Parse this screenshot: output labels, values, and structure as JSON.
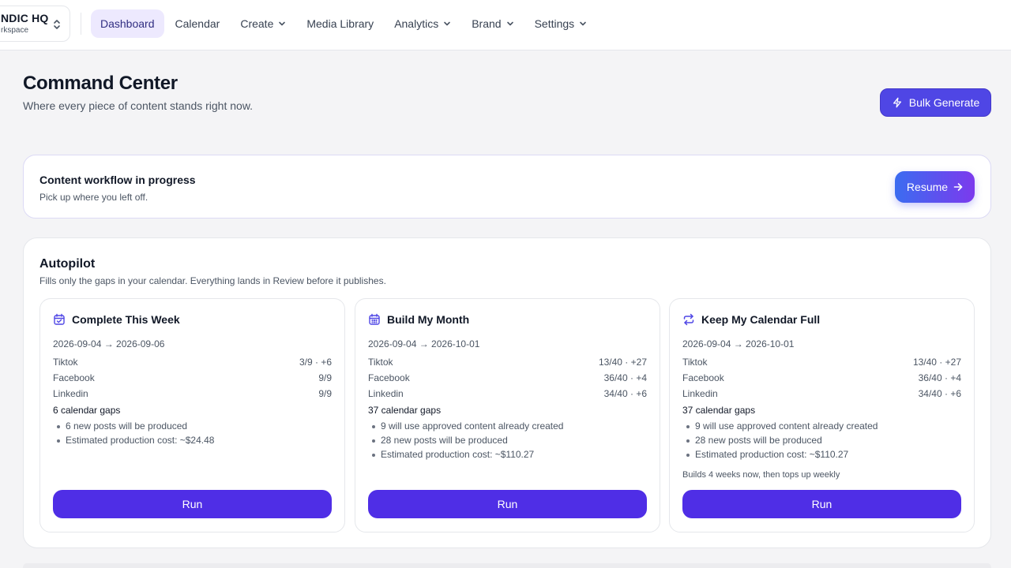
{
  "workspace": {
    "name": "NDIC HQ",
    "sub": "rkspace"
  },
  "nav": {
    "items": [
      {
        "label": "Dashboard",
        "active": true,
        "dropdown": false
      },
      {
        "label": "Calendar",
        "active": false,
        "dropdown": false
      },
      {
        "label": "Create",
        "active": false,
        "dropdown": true
      },
      {
        "label": "Media Library",
        "active": false,
        "dropdown": false
      },
      {
        "label": "Analytics",
        "active": false,
        "dropdown": true
      },
      {
        "label": "Brand",
        "active": false,
        "dropdown": true
      },
      {
        "label": "Settings",
        "active": false,
        "dropdown": true
      }
    ]
  },
  "header": {
    "title": "Command Center",
    "subtitle": "Where every piece of content stands right now.",
    "bulk_label": "Bulk Generate"
  },
  "banner": {
    "title": "Content workflow in progress",
    "subtitle": "Pick up where you left off.",
    "resume_label": "Resume"
  },
  "autopilot": {
    "title": "Autopilot",
    "subtitle": "Fills only the gaps in your calendar. Everything lands in Review before it publishes.",
    "cards": [
      {
        "title": "Complete This Week",
        "icon": "calendar-check-icon",
        "range": "2026-09-04 → 2026-09-06",
        "rows": [
          {
            "platform": "Tiktok",
            "value": "3/9 · +6"
          },
          {
            "platform": "Facebook",
            "value": "9/9"
          },
          {
            "platform": "Linkedin",
            "value": "9/9"
          }
        ],
        "gaps": "6 calendar gaps",
        "bullets": [
          "6 new posts will be produced",
          "Estimated production cost: ~$24.48"
        ],
        "note": "",
        "run_label": "Run"
      },
      {
        "title": "Build My Month",
        "icon": "calendar-grid-icon",
        "range": "2026-09-04 → 2026-10-01",
        "rows": [
          {
            "platform": "Tiktok",
            "value": "13/40 · +27"
          },
          {
            "platform": "Facebook",
            "value": "36/40 · +4"
          },
          {
            "platform": "Linkedin",
            "value": "34/40 · +6"
          }
        ],
        "gaps": "37 calendar gaps",
        "bullets": [
          "9 will use approved content already created",
          "28 new posts will be produced",
          "Estimated production cost: ~$110.27"
        ],
        "note": "",
        "run_label": "Run"
      },
      {
        "title": "Keep My Calendar Full",
        "icon": "repeat-icon",
        "range": "2026-09-04 → 2026-10-01",
        "rows": [
          {
            "platform": "Tiktok",
            "value": "13/40 · +27"
          },
          {
            "platform": "Facebook",
            "value": "36/40 · +4"
          },
          {
            "platform": "Linkedin",
            "value": "34/40 · +6"
          }
        ],
        "gaps": "37 calendar gaps",
        "bullets": [
          "9 will use approved content already created",
          "28 new posts will be produced",
          "Estimated production cost: ~$110.27"
        ],
        "note": "Builds 4 weeks now, then tops up weekly",
        "run_label": "Run"
      }
    ]
  },
  "colors": {
    "accent": "#4f46e5",
    "run": "#4f2ee6",
    "active_nav_bg": "#ede9fe",
    "page_bg": "#f4f4f6"
  }
}
